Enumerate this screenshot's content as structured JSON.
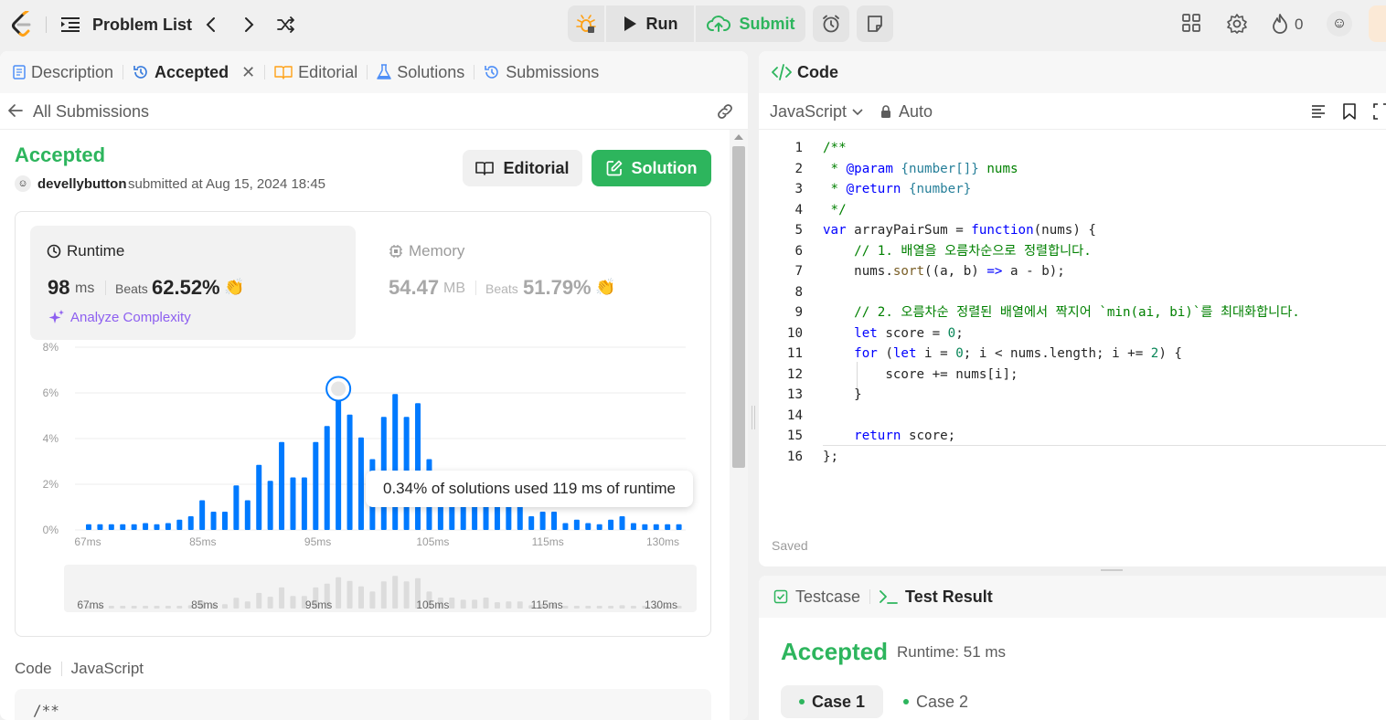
{
  "topnav": {
    "problem_list": "Problem List",
    "run": "Run",
    "submit": "Submit",
    "streak": "0",
    "icons": [
      "leetcode-logo-icon",
      "list-icon",
      "chevron-left-icon",
      "chevron-right-icon",
      "shuffle-icon",
      "bug-icon",
      "play-icon",
      "cloud-upload-icon",
      "alarm-icon",
      "note-icon",
      "grid-icon",
      "gear-icon",
      "fire-icon",
      "avatar-icon"
    ]
  },
  "left_tabs": [
    {
      "label": "Description",
      "icon": "document-icon"
    },
    {
      "label": "Accepted",
      "icon": "history-icon",
      "active": true
    },
    {
      "label": "Editorial",
      "icon": "book-icon"
    },
    {
      "label": "Solutions",
      "icon": "flask-icon"
    },
    {
      "label": "Submissions",
      "icon": "history-icon"
    }
  ],
  "submission": {
    "back_label": "All Submissions",
    "status": "Accepted",
    "user": "develly",
    "user_bold": "develly",
    "username": "devellybutton",
    "submitted_at": "submitted at Aug 15, 2024 18:45",
    "editorial_btn": "Editorial",
    "solution_btn": "Solution"
  },
  "runtime": {
    "label": "Runtime",
    "value": "98",
    "unit": "ms",
    "beats_label": "Beats",
    "beats_pct": "62.52%",
    "analyze": "Analyze Complexity"
  },
  "memory": {
    "label": "Memory",
    "value": "54.47",
    "unit": "MB",
    "beats_label": "Beats",
    "beats_pct": "51.79%"
  },
  "tooltip": "0.34% of solutions used 119 ms of runtime",
  "chart_data": {
    "type": "bar",
    "y_ticks": [
      "8%",
      "6%",
      "4%",
      "2%",
      "0%"
    ],
    "ylim": [
      0,
      8
    ],
    "x_tick_labels": [
      "67ms",
      "85ms",
      "95ms",
      "105ms",
      "115ms",
      "130ms"
    ],
    "values": [
      0.25,
      0.25,
      0.25,
      0.25,
      0.25,
      0.3,
      0.25,
      0.3,
      0.45,
      0.6,
      1.3,
      0.8,
      0.8,
      1.95,
      1.3,
      2.85,
      2.15,
      3.85,
      2.3,
      2.3,
      3.85,
      4.55,
      5.7,
      5.05,
      4.05,
      3.1,
      4.95,
      5.95,
      4.95,
      5.55,
      3.1,
      2.0,
      2.0,
      1.6,
      1.6,
      2.0,
      1.15,
      1.3,
      1.3,
      0.6,
      0.8,
      0.8,
      0.3,
      0.45,
      0.3,
      0.25,
      0.45,
      0.6,
      0.3,
      0.25,
      0.25,
      0.25,
      0.25
    ],
    "highlight_index": 22,
    "minimap_labels": [
      "67ms",
      "85ms",
      "95ms",
      "105ms",
      "115ms",
      "130ms"
    ]
  },
  "code_section": {
    "label": "Code",
    "lang": "JavaScript",
    "preview": "/**"
  },
  "code_panel": {
    "title": "Code",
    "language": "JavaScript",
    "mode": "Auto",
    "saved": "Saved",
    "lines": [
      {
        "n": "1",
        "text": "/**"
      },
      {
        "n": "2",
        "text": " * @param {number[]} nums"
      },
      {
        "n": "3",
        "text": " * @return {number}"
      },
      {
        "n": "4",
        "text": " */"
      },
      {
        "n": "5",
        "text": "var arrayPairSum = function(nums) {"
      },
      {
        "n": "6",
        "text": "    // 1. 배열을 오름차순으로 정렬합니다."
      },
      {
        "n": "7",
        "text": "    nums.sort((a, b) => a - b);"
      },
      {
        "n": "8",
        "text": ""
      },
      {
        "n": "9",
        "text": "    // 2. 오름차순 정렬된 배열에서 짝지어 `min(ai, bi)`를 최대화합니다."
      },
      {
        "n": "10",
        "text": "    let score = 0;"
      },
      {
        "n": "11",
        "text": "    for (let i = 0; i < nums.length; i += 2) {"
      },
      {
        "n": "12",
        "text": "        score += nums[i];"
      },
      {
        "n": "13",
        "text": "    }"
      },
      {
        "n": "14",
        "text": ""
      },
      {
        "n": "15",
        "text": "    return score;"
      },
      {
        "n": "16",
        "text": "};"
      }
    ]
  },
  "result_panel": {
    "testcase_tab": "Testcase",
    "result_tab": "Test Result",
    "status": "Accepted",
    "runtime": "Runtime: 51 ms",
    "case1": "Case 1",
    "case2": "Case 2"
  },
  "colors": {
    "green": "#2db55d",
    "bar_blue": "#007aff",
    "purple": "#8d5ff0"
  }
}
